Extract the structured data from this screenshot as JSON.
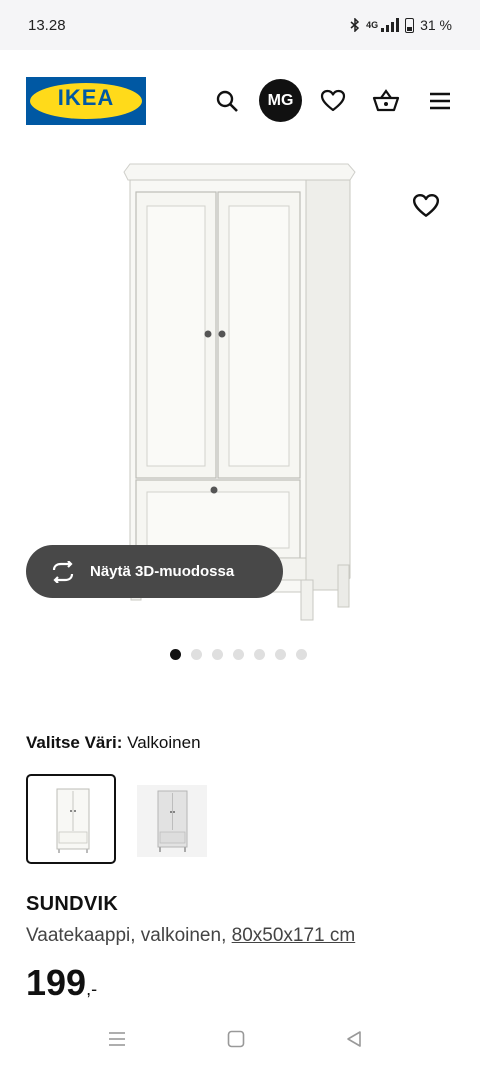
{
  "status_bar": {
    "time": "13.28",
    "network": "4G",
    "battery": "31 %"
  },
  "header": {
    "logo_text": "IKEA",
    "user_initials": "MG",
    "icons": [
      "search-icon",
      "heart-icon",
      "basket-icon",
      "menu-icon"
    ]
  },
  "gallery": {
    "view_3d_label": "Näytä 3D-muodossa",
    "image_count": 7,
    "active_index": 1
  },
  "color_selector": {
    "label": "Valitse Väri:",
    "selected_value": "Valkoinen"
  },
  "product": {
    "name": "SUNDVIK",
    "description": "Vaatekaappi, valkoinen,",
    "dimensions": "80x50x171 cm",
    "price_integer": "199",
    "price_decimal": ",-"
  },
  "colors": {
    "ikea_blue": "#0058a3",
    "ikea_yellow": "#ffda1a",
    "button_dark": "#484848"
  }
}
